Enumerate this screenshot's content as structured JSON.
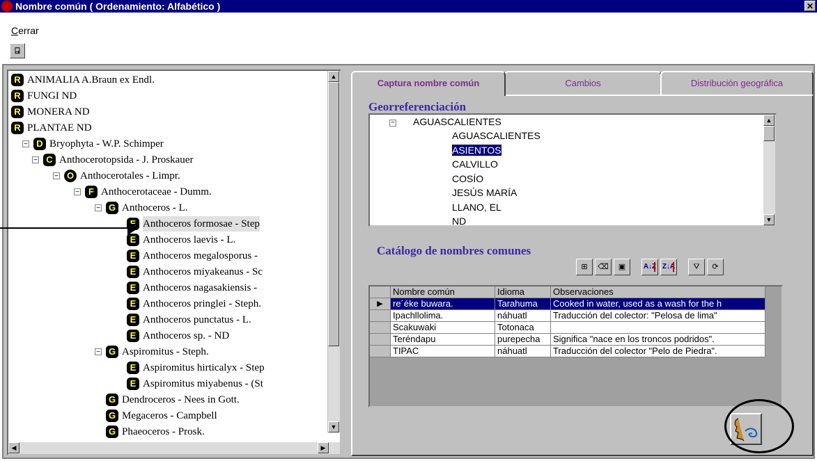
{
  "window": {
    "title": "Nombre común ( Ordenamiento: Alfabético )",
    "close_glyph": "✕"
  },
  "menu": {
    "close_label": "Cerrar"
  },
  "toolbar": {
    "exit_icon": "exit-door-icon",
    "exit_glyph": "⍈"
  },
  "tree": {
    "items": [
      {
        "rank": "R",
        "label": "ANIMALIA A.Braun ex Endl."
      },
      {
        "rank": "R",
        "label": "FUNGI ND"
      },
      {
        "rank": "R",
        "label": "MONERA ND"
      },
      {
        "rank": "R",
        "label": "PLANTAE ND"
      },
      {
        "rank": "D",
        "label": "Bryophyta - W.P. Schimper",
        "expander": "−"
      },
      {
        "rank": "C",
        "label": "Anthocerotopsida - J. Proskauer",
        "expander": "−"
      },
      {
        "rank": "O",
        "label": "Anthocerotales - Limpr.",
        "expander": "−"
      },
      {
        "rank": "F",
        "label": "Anthocerotaceae - Dumm.",
        "expander": "−"
      },
      {
        "rank": "G",
        "label": "Anthoceros - L.",
        "expander": "−"
      },
      {
        "rank": "E",
        "label": "Anthoceros formosae - Step"
      },
      {
        "rank": "E",
        "label": "Anthoceros laevis - L."
      },
      {
        "rank": "E",
        "label": "Anthoceros megalosporus -"
      },
      {
        "rank": "E",
        "label": "Anthoceros miyakeanus - Sc"
      },
      {
        "rank": "E",
        "label": "Anthoceros nagasakiensis -"
      },
      {
        "rank": "E",
        "label": "Anthoceros pringlei - Steph."
      },
      {
        "rank": "E",
        "label": "Anthoceros punctatus - L."
      },
      {
        "rank": "E",
        "label": "Anthoceros sp. - ND"
      },
      {
        "rank": "G",
        "label": "Aspiromitus - Steph.",
        "expander": "−"
      },
      {
        "rank": "E",
        "label": "Aspiromitus hirticalyx - Step"
      },
      {
        "rank": "E",
        "label": "Aspiromitus miyabenus - (St"
      },
      {
        "rank": "G",
        "label": "Dendroceros - Nees in Gott."
      },
      {
        "rank": "G",
        "label": "Megaceros - Campbell"
      },
      {
        "rank": "G",
        "label": "Phaeoceros - Prosk."
      }
    ],
    "selected_index": 9
  },
  "tabs": [
    {
      "label": "Captura nombre común",
      "active": true
    },
    {
      "label": "Cambios",
      "active": false
    },
    {
      "label": "Distribución geográfica",
      "active": false
    }
  ],
  "georef": {
    "title": "Georreferenciación",
    "parent": "AGUASCALIENTES",
    "parent_expander": "−",
    "children": [
      "AGUASCALIENTES",
      "ASIENTOS",
      "CALVILLO",
      "COSÍO",
      "JESÚS MARÍA",
      "LLANO, EL",
      "ND"
    ],
    "selected": "ASIENTOS"
  },
  "catalog": {
    "title": "Catálogo de nombres comunes",
    "toolbar": [
      {
        "name": "insert-record-icon",
        "glyph": "⊞"
      },
      {
        "name": "eraser-icon",
        "glyph": "⌫"
      },
      {
        "name": "save-icon",
        "glyph": "▣"
      },
      {
        "name": "sort-ascending-icon",
        "glyph": "A↓Z"
      },
      {
        "name": "sort-descending-icon",
        "glyph": "Z↓A"
      },
      {
        "name": "filter-icon",
        "glyph": "⛛"
      },
      {
        "name": "refresh-icon",
        "glyph": "⟳"
      }
    ],
    "columns": [
      "Nombre común",
      "Idioma",
      "Observaciones"
    ],
    "rows": [
      {
        "name": "re´éke buwara.",
        "lang": "Tarahuma",
        "obs": "Cooked in water, used as a wash for the h",
        "current": true
      },
      {
        "name": "Ipachllolima.",
        "lang": "náhuatl",
        "obs": "Traducción del colector: \"Pelosa de lima\""
      },
      {
        "name": "Scakuwaki",
        "lang": "Totonaca",
        "obs": ""
      },
      {
        "name": "Teréndapu",
        "lang": "purepecha",
        "obs": "Significa \"nace en los troncos podridos\"."
      },
      {
        "name": "TIPAC",
        "lang": "náhuatl",
        "obs": "Traducción del colector \"Pelo de Piedra\"."
      }
    ],
    "row_indicator": "▶"
  },
  "action_button": {
    "icon": "speaking-head-icon"
  },
  "colors": {
    "title_bar": "#000080",
    "tab_text": "#7b2d8b",
    "section_title": "#3a2aa0",
    "rank_badge_fg": "#ffff40",
    "selection": "#000080"
  }
}
